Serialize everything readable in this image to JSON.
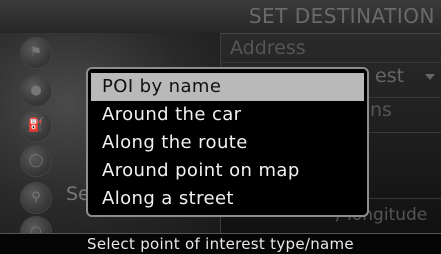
{
  "header": {
    "title": "SET DESTINATION"
  },
  "background_list": {
    "address_label": "Address",
    "partial_interest": "est",
    "partial_options": "ns",
    "left_partial": "Se",
    "partial_latlong": "/ longitude"
  },
  "icons": [
    "flag-icon",
    "poi-icon",
    "gas-icon",
    "car-icon",
    "pin-icon",
    "globe-icon"
  ],
  "popup": {
    "items": [
      {
        "label": "POI by name",
        "selected": true
      },
      {
        "label": "Around the car",
        "selected": false
      },
      {
        "label": "Along the route",
        "selected": false
      },
      {
        "label": "Around point on map",
        "selected": false
      },
      {
        "label": "Along a street",
        "selected": false
      }
    ]
  },
  "status": {
    "text": "Select point of interest type/name"
  },
  "colors": {
    "highlight": "#b9b9b9",
    "popup_bg": "#000000",
    "text": "#f2f2f2"
  }
}
